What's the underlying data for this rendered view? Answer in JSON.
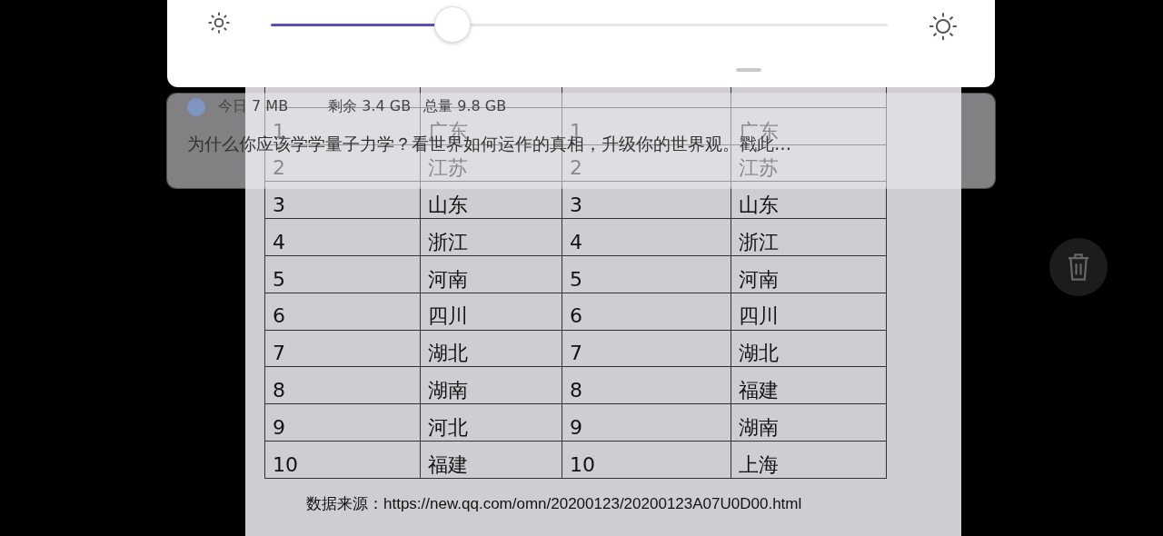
{
  "brightness": {
    "level": 0.295
  },
  "notification": {
    "usage": [
      "今日 7 MB",
      "剩余 3.4 GB",
      "总量 9.8 GB"
    ],
    "headline": "为什么你应该学学量子力学？看世界如何运作的真相，升级你的世界观。戳此…"
  },
  "table": {
    "rows": [
      [
        "1",
        "广东",
        "1",
        "广东"
      ],
      [
        "2",
        "江苏",
        "2",
        "江苏"
      ],
      [
        "3",
        "山东",
        "3",
        "山东"
      ],
      [
        "4",
        "浙江",
        "4",
        "浙江"
      ],
      [
        "5",
        "河南",
        "5",
        "河南"
      ],
      [
        "6",
        "四川",
        "6",
        "四川"
      ],
      [
        "7",
        "湖北",
        "7",
        "湖北"
      ],
      [
        "8",
        "湖南",
        "8",
        "福建"
      ],
      [
        "9",
        "河北",
        "9",
        "湖南"
      ],
      [
        "10",
        "福建",
        "10",
        "上海"
      ]
    ]
  },
  "source": "数据来源：https://new.qq.com/omn/20200123/20200123A07U0D00.html"
}
